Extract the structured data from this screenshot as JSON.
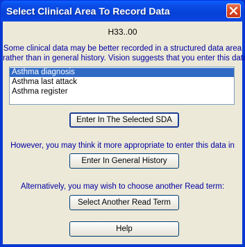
{
  "window": {
    "title": "Select Clinical Area To Record Data"
  },
  "read_code": "H33..00",
  "intro_line1": "Some clinical data may be better recorded in a structured data area",
  "intro_line2": "rather than in general history. Vision suggests that you enter this data",
  "list": {
    "items": [
      "Asthma diagnosis",
      "Asthma last attack",
      "Asthma register"
    ],
    "selected_index": 0
  },
  "buttons": {
    "enter_sda": "Enter In The Selected SDA",
    "general_history": "Enter In General History",
    "another_term": "Select Another Read Term",
    "help": "Help"
  },
  "prompt_general_history": "However, you may think it more appropriate to enter this data in",
  "prompt_another_term": "Alternatively, you may wish to choose another Read term:",
  "colors": {
    "title_bar": "#0a46e0",
    "dialog_bg": "#ece9d8",
    "instruction_text": "#0000a0",
    "selection": "#316ac5",
    "close_button": "#d9441d"
  }
}
